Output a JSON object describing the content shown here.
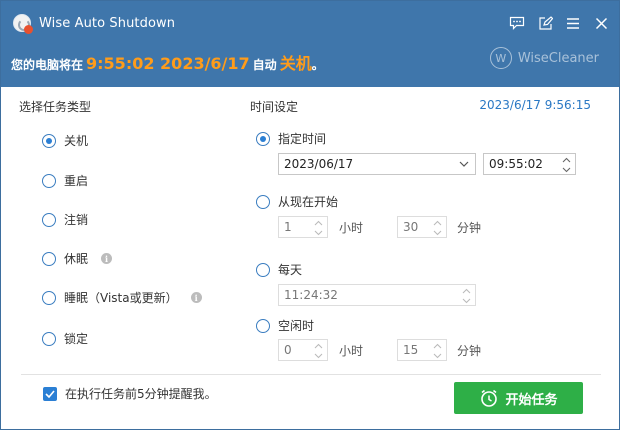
{
  "window": {
    "title": "Wise Auto Shutdown"
  },
  "header": {
    "prefix": "您的电脑将在",
    "time": "9:55:02 2023/6/17",
    "middle": "自动",
    "action": "关机",
    "suffix": "。",
    "brand": "WiseCleaner",
    "brand_mark": "W",
    "icons": [
      "feedback-icon",
      "edit-icon",
      "menu-icon",
      "close-icon"
    ]
  },
  "task_type": {
    "title": "选择任务类型",
    "options": [
      {
        "label": "关机",
        "selected": true,
        "info": false
      },
      {
        "label": "重启",
        "selected": false,
        "info": false
      },
      {
        "label": "注销",
        "selected": false,
        "info": false
      },
      {
        "label": "休眠",
        "selected": false,
        "info": true
      },
      {
        "label": "睡眠（Vista或更新）",
        "selected": false,
        "info": true
      },
      {
        "label": "锁定",
        "selected": false,
        "info": false
      }
    ],
    "info_glyph": "i"
  },
  "time_settings": {
    "title": "时间设定",
    "current_datetime": "2023/6/17  9:56:15",
    "specified": {
      "label": "指定时间",
      "selected": true,
      "date": "2023/06/17",
      "time": "09:55:02"
    },
    "from_now": {
      "label": "从现在开始",
      "selected": false,
      "hours": "1",
      "hours_unit": "小时",
      "minutes": "30",
      "minutes_unit": "分钟"
    },
    "daily": {
      "label": "每天",
      "selected": false,
      "time": "11:24:32"
    },
    "idle": {
      "label": "空闲时",
      "selected": false,
      "hours": "0",
      "hours_unit": "小时",
      "minutes": "15",
      "minutes_unit": "分钟"
    }
  },
  "footer": {
    "remind_label": "在执行任务前5分钟提醒我。",
    "remind_checked": true,
    "start_label": "开始任务"
  },
  "colors": {
    "header_bg": "#3f76ab",
    "accent_orange": "#ff9c1a",
    "accent_blue": "#2b7fd4",
    "button_green": "#2eaf47"
  }
}
